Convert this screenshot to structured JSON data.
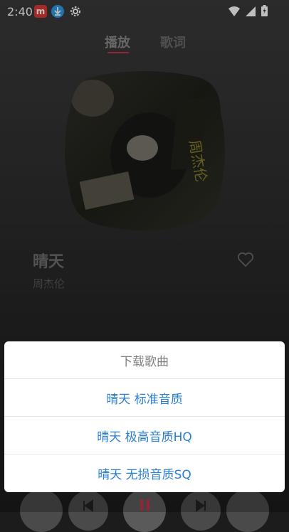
{
  "status_bar": {
    "time": "2:40",
    "icons": [
      "netease-music-icon",
      "download-icon",
      "settings-gear-icon",
      "wifi-icon",
      "signal-icon",
      "battery-icon"
    ]
  },
  "tabs": [
    {
      "label": "播放",
      "active": true
    },
    {
      "label": "歌词",
      "active": false
    }
  ],
  "song": {
    "title": "晴天",
    "artist": "周杰伦"
  },
  "download_sheet": {
    "title": "下载歌曲",
    "options": [
      {
        "label": "晴天 标准音质"
      },
      {
        "label": "晴天 极高音质HQ"
      },
      {
        "label": "晴天 无损音质SQ"
      }
    ]
  },
  "colors": {
    "accent": "#c9304a",
    "option_text": "#2a7fd4",
    "sheet_bg": "#ffffff"
  }
}
